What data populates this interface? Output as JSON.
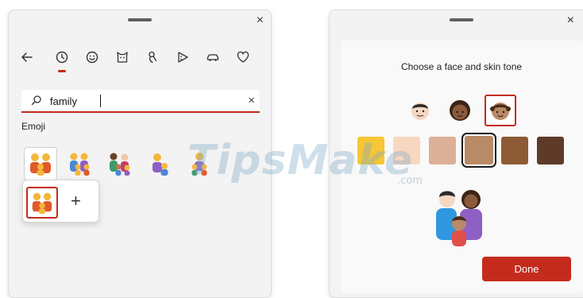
{
  "emoji_panel": {
    "nav_icons": [
      "back-arrow-icon",
      "recent-clock-icon",
      "smiley-icon",
      "cat-icon",
      "people-icon",
      "pizza-icon",
      "car-icon",
      "heart-icon"
    ],
    "search": {
      "value": "family",
      "clear_label": "×"
    },
    "section_label": "Emoji",
    "close_label": "×",
    "variant_add_label": "+"
  },
  "skin_tone_dialog": {
    "close_label": "×",
    "title": "Choose a face and skin tone",
    "skin_tones": [
      "#f7c535",
      "#f8d7c0",
      "#dcb096",
      "#b98a66",
      "#8c5a34",
      "#5e3b28"
    ],
    "selected_tone_index": 3,
    "selected_face_index": 2,
    "done_label": "Done"
  },
  "watermark": {
    "text": "TipsMake",
    "suffix": ".com"
  },
  "colors": {
    "accent": "#c42b1c",
    "panel_bg": "#f3f3f3"
  }
}
